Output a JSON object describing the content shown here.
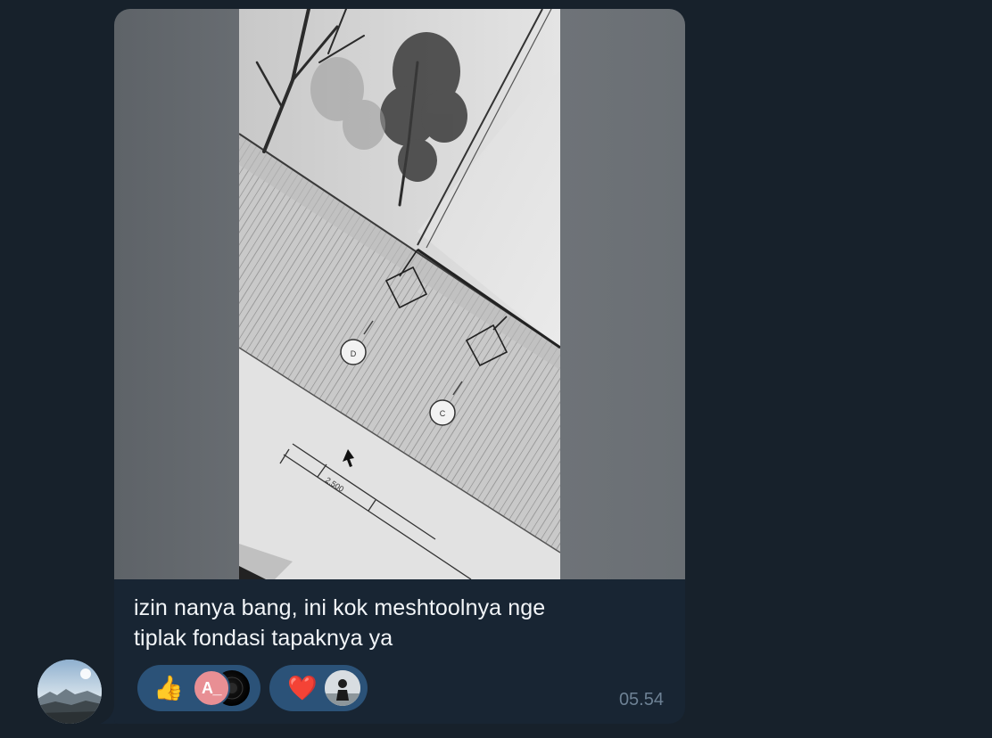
{
  "message": {
    "caption_lines": [
      "izin nanya bang, ini kok meshtoolnya nge",
      "tiplak fondasi tapaknya ya"
    ],
    "time": "05.54",
    "photo_labels": {
      "grid_d": "D",
      "grid_c": "C",
      "dimension": "2.500"
    }
  },
  "reactions": [
    {
      "emoji": "👍",
      "icon": "thumbs-up-icon",
      "users": [
        {
          "initials": "A_",
          "color": "#e88f94"
        },
        {
          "avatar": "dark-avatar"
        }
      ]
    },
    {
      "emoji": "❤️",
      "icon": "heart-icon",
      "users": [
        {
          "avatar": "person-avatar"
        }
      ]
    }
  ],
  "colors": {
    "background": "#17212b",
    "bubble": "#182533",
    "reaction_pill": "#2b5278",
    "time_text": "#6d8194"
  }
}
